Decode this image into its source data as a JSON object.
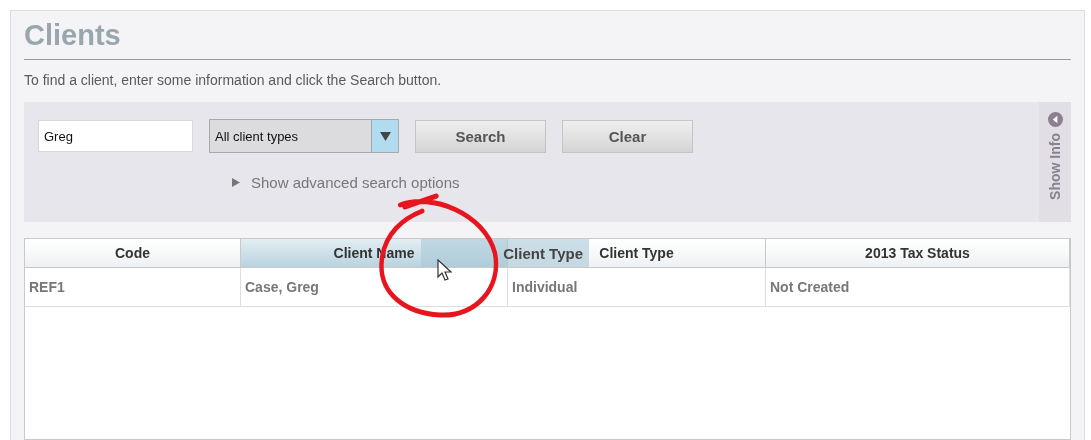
{
  "page": {
    "title": "Clients",
    "instructions": "To find a client, enter some information and click the Search button."
  },
  "search": {
    "query": "Greg",
    "client_type": "All client types",
    "buttons": [
      "Search",
      "Clear"
    ],
    "advanced_toggle": {
      "label": "Show advanced search options",
      "expanded": false
    },
    "side_tab": {
      "label": "Show Info",
      "expanded": false
    }
  },
  "table": {
    "columns": [
      {
        "label": "Code",
        "highlighted": false
      },
      {
        "label": "Client Name",
        "highlighted": true
      },
      {
        "label": "Client Type",
        "highlighted": false
      },
      {
        "label": "2013 Tax Status",
        "highlighted": false
      }
    ],
    "dragged_column": {
      "label": "Client Type"
    },
    "rows": [
      {
        "cells": [
          "REF1",
          "Case, Greg",
          "Individual",
          "Not Created"
        ],
        "selected": false
      }
    ]
  }
}
